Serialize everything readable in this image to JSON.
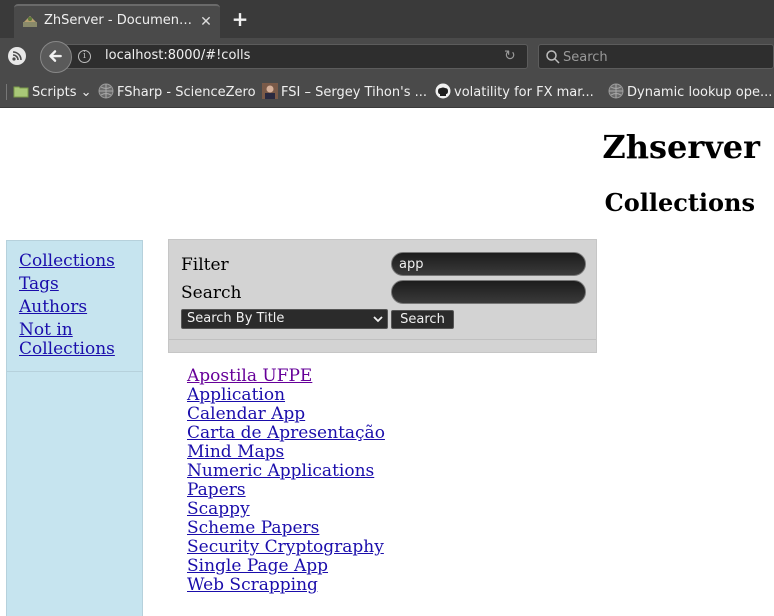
{
  "browser": {
    "tab_title": "ZhServer - Document...",
    "url": "localhost:8000/#!colls",
    "search_placeholder": "Search",
    "bookmarks": [
      {
        "label": "Scripts",
        "icon": "folder-icon"
      },
      {
        "label": "FSharp - ScienceZero",
        "icon": "globe-icon"
      },
      {
        "label": "FSI – Sergey Tihon's ...",
        "icon": "avatar-icon"
      },
      {
        "label": "volatility for FX mar...",
        "icon": "github-icon"
      },
      {
        "label": "Dynamic lookup ope...",
        "icon": "globe-icon"
      }
    ]
  },
  "page": {
    "site_title": "Zhserver",
    "section_title": "Collections",
    "sidebar": {
      "links": [
        "Collections",
        "Tags",
        "Authors",
        "Not in Collections"
      ]
    },
    "filter": {
      "filter_label": "Filter",
      "filter_value": "app",
      "search_label": "Search",
      "search_value": "",
      "select_value": "Search By Title",
      "search_button": "Search"
    },
    "results": [
      "Apostila UFPE",
      "Application",
      "Calendar App",
      "Carta de Apresentação",
      "Mind Maps",
      "Numeric Applications",
      "Papers",
      "Scappy",
      "Scheme Papers",
      "Security Cryptography",
      "Single Page App",
      "Web Scrapping"
    ],
    "visited_result_index": 0
  },
  "colors": {
    "link": "#1a0dab",
    "visited_link": "#660099",
    "sidebar_bg": "#c6e4ef",
    "panel_bg": "#d3d3d3",
    "chrome_dark": "#3a3a3a"
  }
}
